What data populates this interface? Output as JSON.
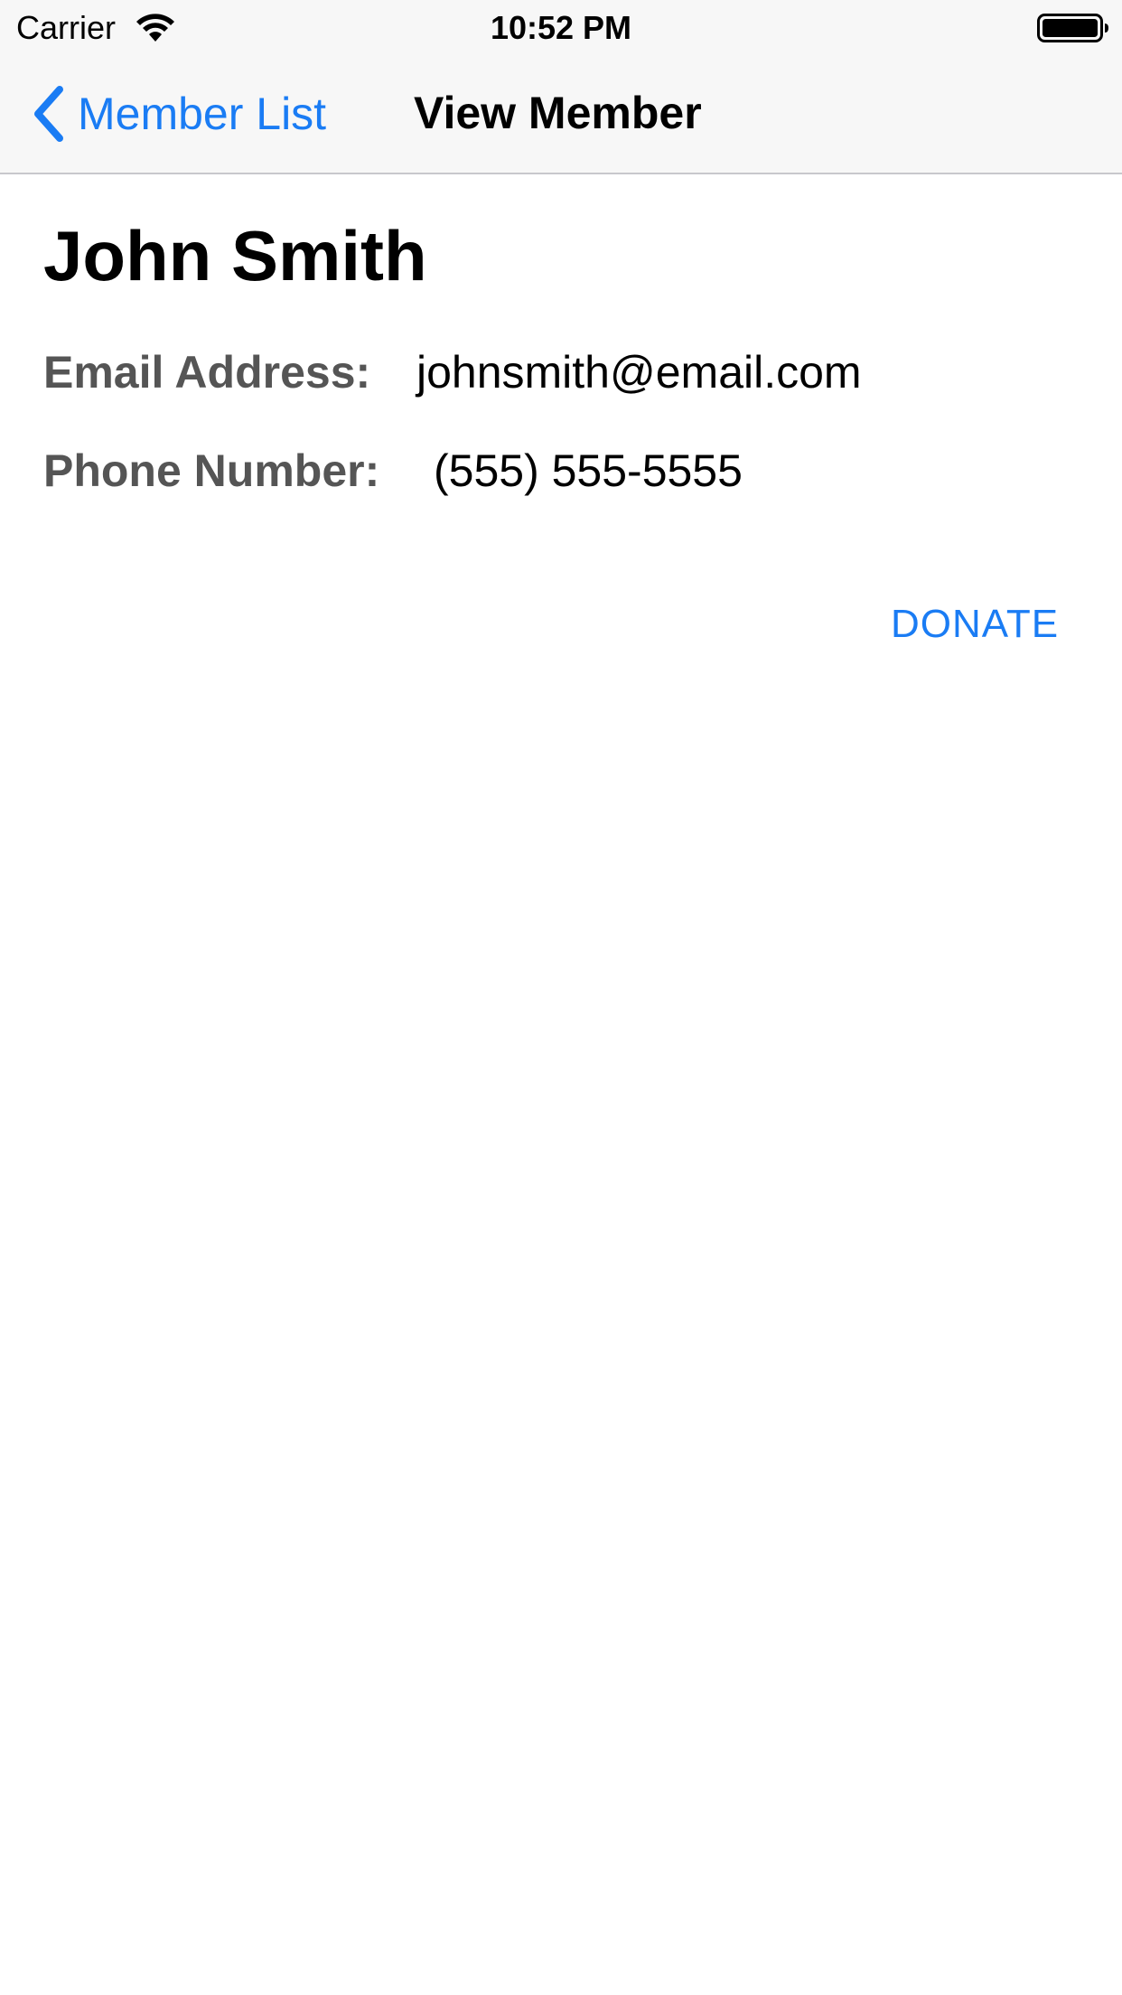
{
  "status_bar": {
    "carrier": "Carrier",
    "time": "10:52 PM",
    "wifi_icon": "wifi-icon",
    "battery_icon": "battery-full-icon"
  },
  "nav": {
    "back_label": "Member List",
    "back_icon": "chevron-left-icon",
    "title": "View Member"
  },
  "member": {
    "name": "John Smith",
    "email_label": "Email Address:",
    "email_value": "johnsmith@email.com",
    "phone_label": "Phone Number:",
    "phone_value": "(555) 555-5555"
  },
  "actions": {
    "donate_label": "DONATE"
  },
  "colors": {
    "accent": "#1a7cf4",
    "label_gray": "#555555",
    "bar_background": "#f7f7f7"
  }
}
